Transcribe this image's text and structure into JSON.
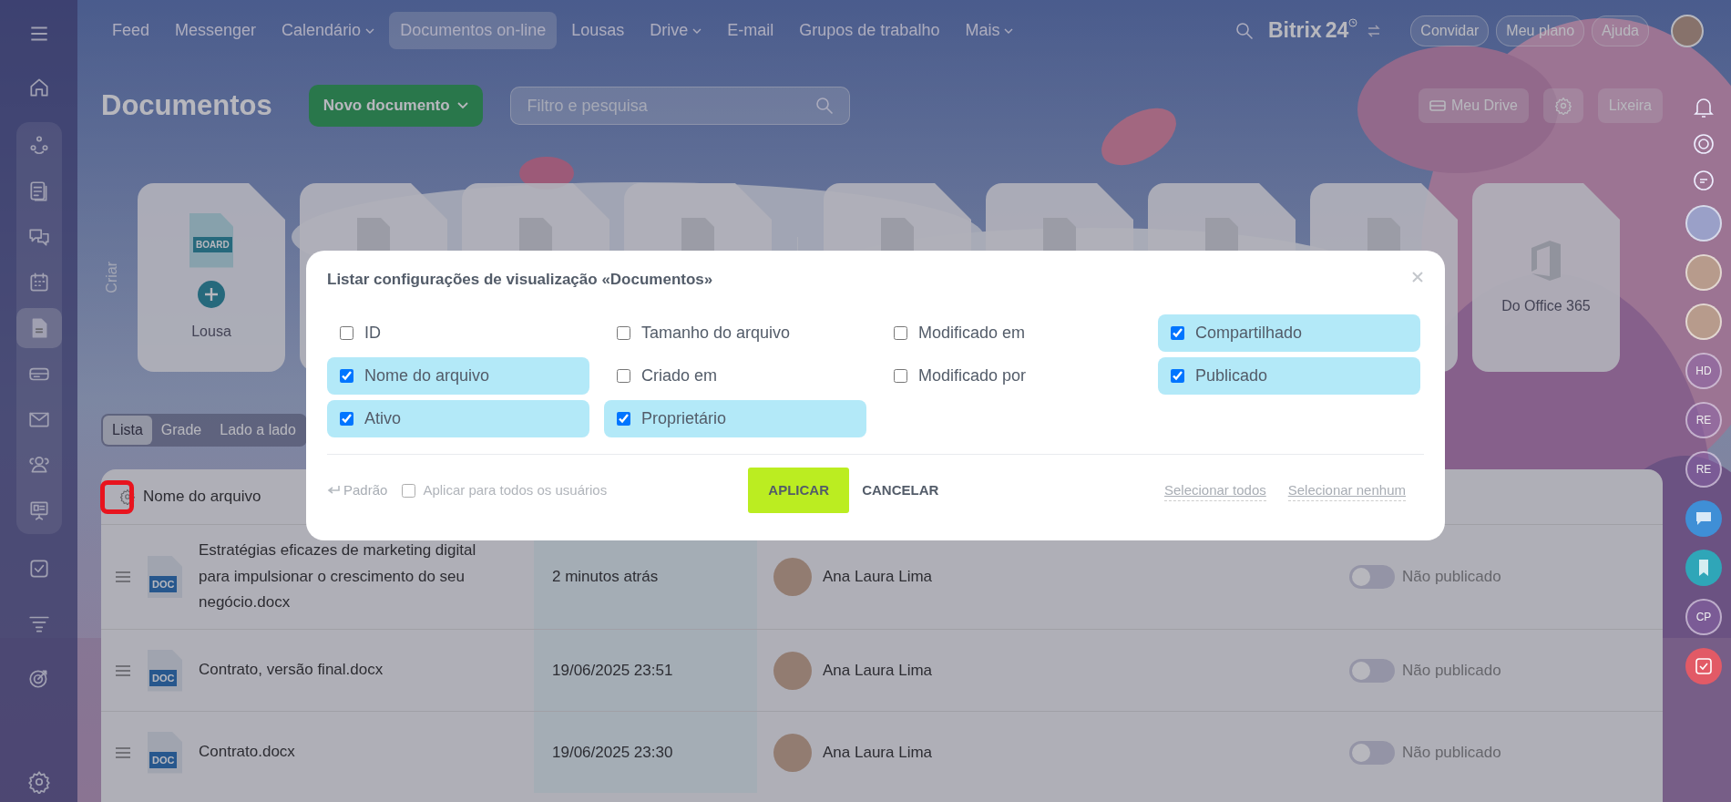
{
  "top_nav": {
    "items": [
      {
        "label": "Feed",
        "selected": false,
        "dropdown": false
      },
      {
        "label": "Messenger",
        "selected": false,
        "dropdown": false
      },
      {
        "label": "Calendário",
        "selected": false,
        "dropdown": true
      },
      {
        "label": "Documentos on-line",
        "selected": true,
        "dropdown": false
      },
      {
        "label": "Lousas",
        "selected": false,
        "dropdown": false
      },
      {
        "label": "Drive",
        "selected": false,
        "dropdown": true
      },
      {
        "label": "E-mail",
        "selected": false,
        "dropdown": false
      },
      {
        "label": "Grupos de trabalho",
        "selected": false,
        "dropdown": false
      },
      {
        "label": "Mais",
        "selected": false,
        "dropdown": true
      }
    ],
    "logo": {
      "name": "Bitrix",
      "number": "24"
    },
    "buttons": [
      "Convidar",
      "Meu plano",
      "Ajuda"
    ]
  },
  "sidebar": {
    "top": [
      {
        "kind": "home",
        "selected": false
      }
    ],
    "group": [
      {
        "kind": "flow",
        "selected": false
      },
      {
        "kind": "feed",
        "selected": false
      },
      {
        "kind": "chat",
        "selected": false
      },
      {
        "kind": "calendar",
        "selected": false
      },
      {
        "kind": "doc",
        "selected": true
      },
      {
        "kind": "drive",
        "selected": false
      },
      {
        "kind": "mail",
        "selected": false
      },
      {
        "kind": "people",
        "selected": false
      },
      {
        "kind": "board",
        "selected": false
      }
    ],
    "bottom": [
      {
        "kind": "task",
        "selected": false
      },
      {
        "kind": "filter",
        "selected": false
      },
      {
        "kind": "target",
        "selected": false
      }
    ],
    "footer": [
      {
        "kind": "settings",
        "selected": false
      }
    ]
  },
  "page": {
    "title": "Documentos",
    "new_button": "Novo documento",
    "search": {
      "placeholder": "Filtro e pesquisa"
    },
    "actions": [
      {
        "kind": "drive",
        "label": "Meu Drive"
      },
      {
        "kind": "gear"
      },
      {
        "kind": "text",
        "label": "Lixeira"
      }
    ]
  },
  "create": {
    "label": "Criar",
    "cards": [
      {
        "kind": "board",
        "badge": "BOARD",
        "label": "Lousa"
      },
      {
        "kind": "file"
      },
      {
        "kind": "file"
      },
      {
        "kind": "file"
      }
    ]
  },
  "import_cards": [
    {
      "kind": "file"
    },
    {
      "kind": "file"
    },
    {
      "kind": "file"
    },
    {
      "kind": "file"
    },
    {
      "kind": "office",
      "label": "Do Office 365"
    }
  ],
  "view_tabs": [
    {
      "label": "Lista",
      "selected": true
    },
    {
      "label": "Grade",
      "selected": false
    },
    {
      "label": "Lado a lado",
      "selected": false
    }
  ],
  "table": {
    "columns": [
      "Nome do arquivo"
    ],
    "rows": [
      {
        "badge": "DOC",
        "name": "Estratégias eficazes de marketing digital para impulsionar o crescimento do seu negócio.docx",
        "modified": "2 minutos atrás",
        "owner": "Ana Laura Lima",
        "published": false,
        "status": "Não publicado"
      },
      {
        "badge": "DOC",
        "name": "Contrato, versão final.docx",
        "modified": "19/06/2025 23:51",
        "owner": "Ana Laura Lima",
        "published": false,
        "status": "Não publicado"
      },
      {
        "badge": "DOC",
        "name": "Contrato.docx",
        "modified": "19/06/2025 23:30",
        "owner": "Ana Laura Lima",
        "published": false,
        "status": "Não publicado"
      }
    ]
  },
  "right_rail": [
    {
      "kind": "bell"
    },
    {
      "kind": "spiral"
    },
    {
      "kind": "chat"
    },
    {
      "kind": "blur"
    },
    {
      "kind": "avatar"
    },
    {
      "kind": "avatar"
    },
    {
      "kind": "initials",
      "text": "HD"
    },
    {
      "kind": "initials",
      "text": "RE"
    },
    {
      "kind": "initials",
      "text": "RE"
    },
    {
      "kind": "message",
      "color": "#3f8fd6"
    },
    {
      "kind": "bookmark",
      "color": "#2fa6b8"
    },
    {
      "kind": "initials",
      "text": "CP"
    },
    {
      "kind": "task",
      "color": "#e25a66"
    }
  ],
  "dialog": {
    "title": "Listar configurações de visualização «Documentos»",
    "options": [
      {
        "label": "ID",
        "checked": false
      },
      {
        "label": "Tamanho do arquivo",
        "checked": false
      },
      {
        "label": "Modificado em",
        "checked": false
      },
      {
        "label": "Compartilhado",
        "checked": true
      },
      {
        "label": "Nome do arquivo",
        "checked": true
      },
      {
        "label": "Criado em",
        "checked": false
      },
      {
        "label": "Modificado por",
        "checked": false
      },
      {
        "label": "Publicado",
        "checked": true
      },
      {
        "label": "Ativo",
        "checked": true
      },
      {
        "label": "Proprietário",
        "checked": true
      }
    ],
    "reset": "Padrão",
    "apply_all": {
      "label": "Aplicar para todos os usuários",
      "checked": false
    },
    "apply": "APLICAR",
    "cancel": "CANCELAR",
    "select_all": "Selecionar todos",
    "select_none": "Selecionar nenhum"
  }
}
